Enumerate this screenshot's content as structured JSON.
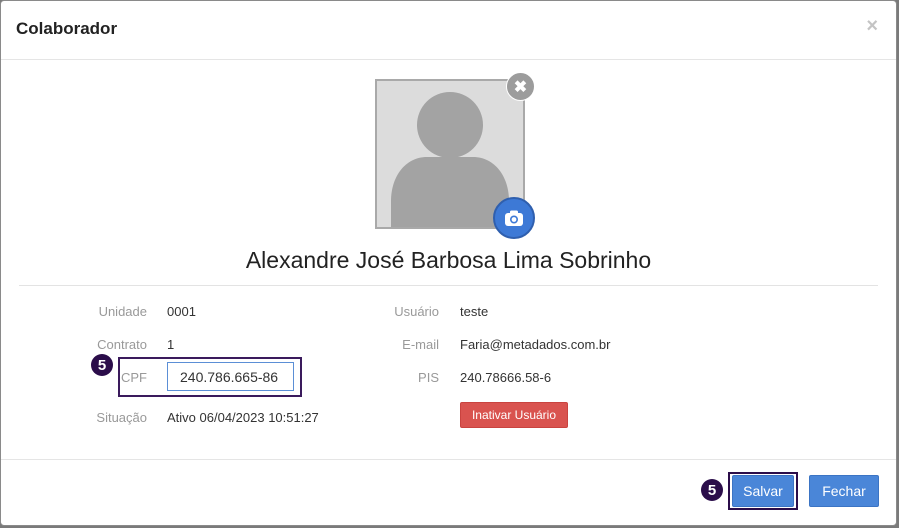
{
  "dialog": {
    "title": "Colaborador",
    "close_glyph": "×",
    "remove_photo_glyph": "✖",
    "name": "Alexandre José Barbosa Lima Sobrinho"
  },
  "fields": {
    "unidade": {
      "label": "Unidade",
      "value": "0001"
    },
    "contrato": {
      "label": "Contrato",
      "value": "1"
    },
    "cpf": {
      "label": "CPF",
      "value": "240.786.665-86"
    },
    "situacao": {
      "label": "Situação",
      "value": "Ativo 06/04/2023 10:51:27"
    },
    "usuario": {
      "label": "Usuário",
      "value": "teste"
    },
    "email": {
      "label": "E-mail",
      "value": "Faria@metadados.com.br"
    },
    "pis": {
      "label": "PIS",
      "value": "240.78666.58-6"
    }
  },
  "buttons": {
    "inativar": "Inativar Usuário",
    "salvar": "Salvar",
    "fechar": "Fechar"
  },
  "badges": {
    "cpf_step": "5",
    "save_step": "5"
  },
  "colors": {
    "primary": "#4a86d8",
    "danger": "#d9534f",
    "badge": "#2b0d4a",
    "camera": "#3d79d6"
  },
  "icons": {
    "photo": "person-placeholder-icon",
    "camera": "camera-icon",
    "remove": "remove-photo-icon",
    "close": "close-icon"
  }
}
